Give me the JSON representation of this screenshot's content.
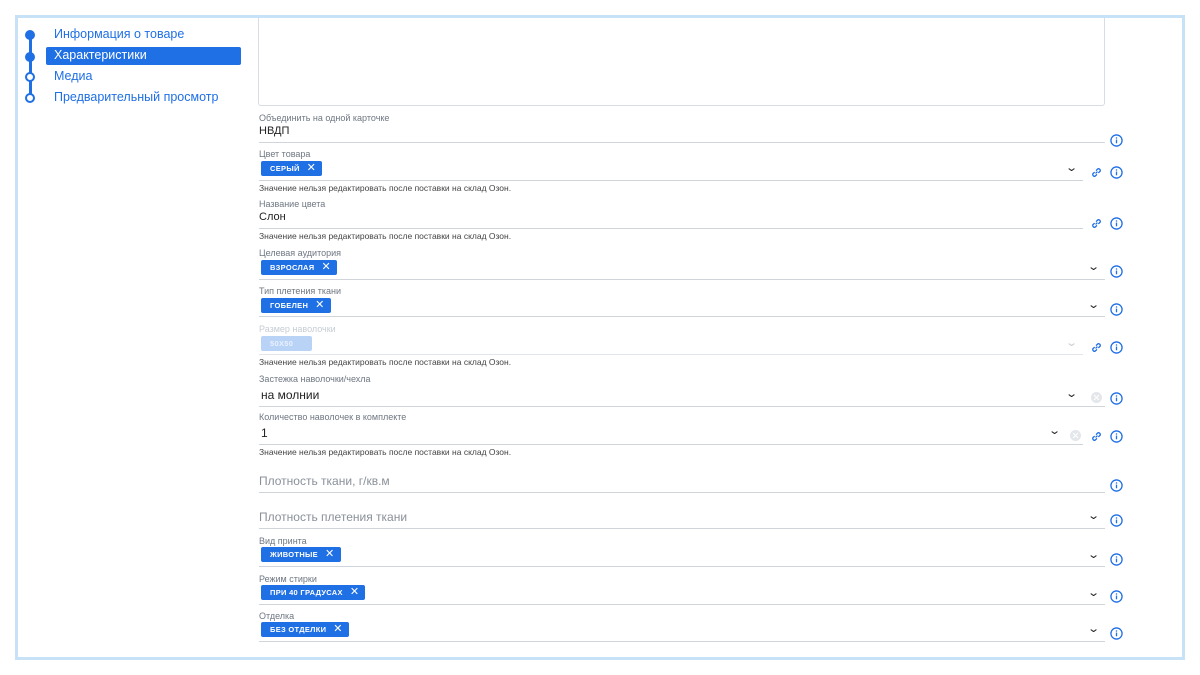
{
  "sidebar": {
    "items": [
      {
        "label": "Информация о товаре",
        "state": "done"
      },
      {
        "label": "Характеристики",
        "state": "active"
      },
      {
        "label": "Медиа",
        "state": "pending"
      },
      {
        "label": "Предварительный просмотр",
        "state": "pending"
      }
    ]
  },
  "hint_text": "Значение нельзя редактировать после поставки на склад Озон.",
  "fields": {
    "merge_card": {
      "label": "Объединить на одной карточке",
      "value": "НВДП"
    },
    "color": {
      "label": "Цвет товара",
      "tag": "СЕРЫЙ"
    },
    "color_name": {
      "label": "Название цвета",
      "value": "Слон"
    },
    "audience": {
      "label": "Целевая аудитория",
      "tag": "ВЗРОСЛАЯ"
    },
    "weave_type": {
      "label": "Тип плетения ткани",
      "tag": "ГОБЕЛЕН"
    },
    "pillow_size": {
      "label": "Размер наволочки",
      "tag": "50X50"
    },
    "closure": {
      "label": "Застежка наволочки/чехла",
      "value": "на молнии"
    },
    "quantity": {
      "label": "Количество наволочек в комплекте",
      "value": "1"
    },
    "fabric_density": {
      "placeholder": "Плотность ткани, г/кв.м"
    },
    "weave_density": {
      "placeholder": "Плотность плетения ткани"
    },
    "print_type": {
      "label": "Вид принта",
      "tag": "ЖИВОТНЫЕ"
    },
    "wash_mode": {
      "label": "Режим стирки",
      "tag": "ПРИ 40 ГРАДУСАХ"
    },
    "finish": {
      "label": "Отделка",
      "tag": "БЕЗ ОТДЕЛКИ"
    }
  },
  "colors": {
    "accent": "#1f6fe5",
    "frame": "#c7e1f7"
  }
}
